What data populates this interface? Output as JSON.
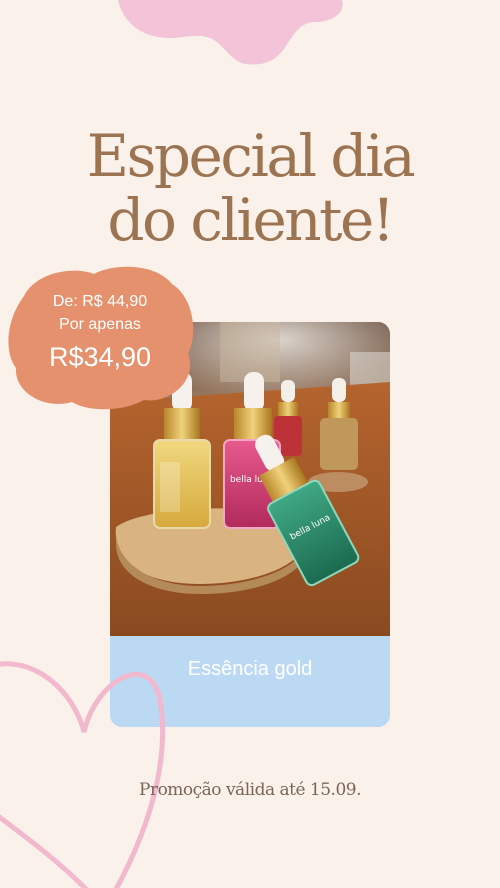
{
  "title": {
    "line1": "Especial dia",
    "line2": "do cliente!"
  },
  "badge": {
    "from": "De: R$ 44,90",
    "only": "Por apenas",
    "price": "R$34,90"
  },
  "product": {
    "caption": "Essência gold",
    "bottle_label": "bella luna",
    "image": "perfume-essence-bottles-photo"
  },
  "footer": {
    "promo": "Promoção válida até 15.09."
  },
  "colors": {
    "background": "#f9f1ea",
    "title": "#9c7452",
    "badge": "#e5916d",
    "caption_bg": "#bcd9f3",
    "decor_pink": "#f3c4d8",
    "heart": "#f2b8cd"
  }
}
